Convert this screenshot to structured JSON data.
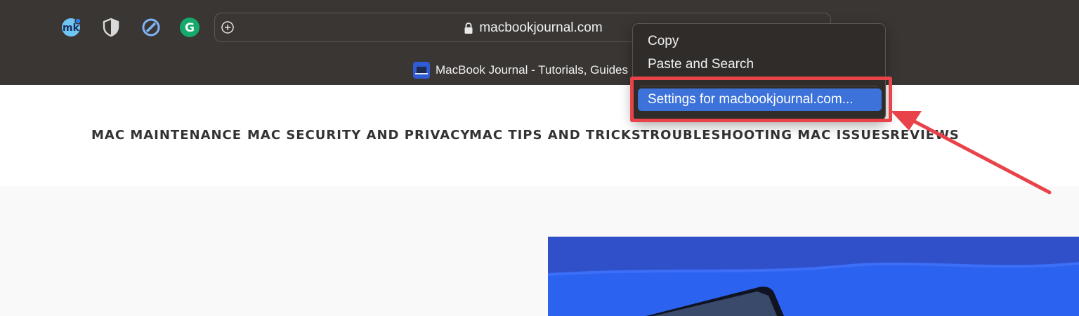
{
  "toolbar": {
    "extensions": [
      {
        "icon": "mk-extension-icon",
        "color": "#6fc6f2"
      },
      {
        "icon": "shield-icon",
        "color": "#d9d9d9"
      },
      {
        "icon": "blocked-icon",
        "color": "#7fb4f5"
      },
      {
        "icon": "grammarly-icon",
        "color": "#15a96b"
      }
    ],
    "address": {
      "url": "macbookjournal.com",
      "add_icon": "plus-circle-icon",
      "lock_icon": "lock-icon"
    },
    "tab_title": "MacBook Journal - Tutorials, Guides"
  },
  "context_menu": {
    "items": [
      "Copy",
      "Paste and Search"
    ],
    "selected_item": "Settings for macbookjournal.com...",
    "highlight_color": "#e9434a",
    "selected_color": "#3c72d9"
  },
  "site": {
    "nav": [
      "MAC MAINTENANCE",
      "MAC SECURITY AND PRIVACY",
      "MAC TIPS AND TRICKS",
      "TROUBLESHOOTING MAC ISSUES",
      "REVIEWS"
    ]
  }
}
